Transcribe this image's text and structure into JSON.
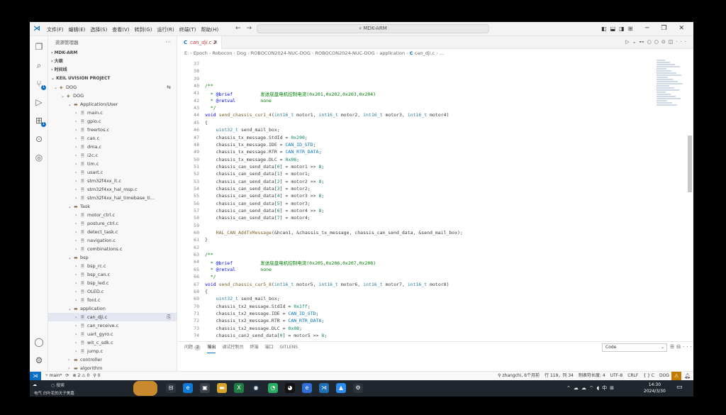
{
  "window": {
    "menus": [
      "文件(F)",
      "编辑(E)",
      "选择(S)",
      "查看(V)",
      "转到(G)",
      "运行(R)",
      "终端(T)",
      "帮助(H)"
    ],
    "command_center": "MDK-ARM"
  },
  "sidebar": {
    "header": "资源管理器",
    "sections": [
      "MDK-ARM",
      "大纲",
      "时间线",
      "KEIL UVISION PROJECT"
    ],
    "tree": [
      {
        "label": "DOG",
        "level": 0,
        "kind": "target",
        "open": true
      },
      {
        "label": "DOG",
        "level": 1,
        "kind": "target",
        "open": true
      },
      {
        "label": "Application/User",
        "level": 2,
        "kind": "folder",
        "open": true
      },
      {
        "label": "main.c",
        "level": 3,
        "kind": "file"
      },
      {
        "label": "gpio.c",
        "level": 3,
        "kind": "file"
      },
      {
        "label": "freertos.c",
        "level": 3,
        "kind": "file"
      },
      {
        "label": "can.c",
        "level": 3,
        "kind": "file"
      },
      {
        "label": "dma.c",
        "level": 3,
        "kind": "file"
      },
      {
        "label": "i2c.c",
        "level": 3,
        "kind": "file"
      },
      {
        "label": "tim.c",
        "level": 3,
        "kind": "file"
      },
      {
        "label": "usart.c",
        "level": 3,
        "kind": "file"
      },
      {
        "label": "stm32f4xx_it.c",
        "level": 3,
        "kind": "file"
      },
      {
        "label": "stm32f4xx_hal_msp.c",
        "level": 3,
        "kind": "file"
      },
      {
        "label": "stm32f4xx_hal_timebase_ti...",
        "level": 3,
        "kind": "file"
      },
      {
        "label": "Task",
        "level": 2,
        "kind": "folder",
        "open": true
      },
      {
        "label": "motor_ctrl.c",
        "level": 3,
        "kind": "file"
      },
      {
        "label": "posture_ctrl.c",
        "level": 3,
        "kind": "file"
      },
      {
        "label": "detect_task.c",
        "level": 3,
        "kind": "file"
      },
      {
        "label": "navigation.c",
        "level": 3,
        "kind": "file"
      },
      {
        "label": "combinations.c",
        "level": 3,
        "kind": "file"
      },
      {
        "label": "bsp",
        "level": 2,
        "kind": "folder",
        "open": true
      },
      {
        "label": "bsp_rc.c",
        "level": 3,
        "kind": "file"
      },
      {
        "label": "bsp_can.c",
        "level": 3,
        "kind": "file"
      },
      {
        "label": "bsp_led.c",
        "level": 3,
        "kind": "file"
      },
      {
        "label": "OLED.c",
        "level": 3,
        "kind": "file"
      },
      {
        "label": "font.c",
        "level": 3,
        "kind": "file"
      },
      {
        "label": "application",
        "level": 2,
        "kind": "folder",
        "open": true
      },
      {
        "label": "can_dji.c",
        "level": 3,
        "kind": "file",
        "selected": true
      },
      {
        "label": "can_receive.c",
        "level": 3,
        "kind": "file"
      },
      {
        "label": "uart_gyro.c",
        "level": 3,
        "kind": "file"
      },
      {
        "label": "wit_c_sdk.c",
        "level": 3,
        "kind": "file"
      },
      {
        "label": "jump.c",
        "level": 3,
        "kind": "file"
      },
      {
        "label": "controller",
        "level": 2,
        "kind": "folder",
        "open": false
      },
      {
        "label": "algorithm",
        "level": 2,
        "kind": "folder",
        "open": false
      }
    ]
  },
  "editor": {
    "tab": {
      "name": "can_dji.c",
      "badge": "2"
    },
    "breadcrumb": [
      "E:",
      "Epoch",
      "Robocon",
      "Dog",
      "ROBOCON2024-NUC-DOG",
      "ROBOCON2024-NUC-DOG",
      "application",
      "can_dji.c",
      "..."
    ],
    "lines": [
      {
        "n": "37",
        "t": ""
      },
      {
        "n": "38",
        "t": ""
      },
      {
        "n": "39",
        "t": ""
      },
      {
        "n": "40",
        "t": "/**"
      },
      {
        "n": "41",
        "t": "  * @brief          发送底盘电机控制电流(0x201,0x202,0x203,0x204)"
      },
      {
        "n": "42",
        "t": "  * @retval         none"
      },
      {
        "n": "43",
        "t": "  */"
      },
      {
        "n": "44",
        "t": "void send_chassis_cur1_4(int16_t motor1, int16_t motor2, int16_t motor3, int16_t motor4)"
      },
      {
        "n": "45",
        "t": "{"
      },
      {
        "n": "46",
        "t": "    uint32_t send_mail_box;"
      },
      {
        "n": "47",
        "t": "    chassis_tx_message.StdId = 0x200;"
      },
      {
        "n": "48",
        "t": "    chassis_tx_message.IDE = CAN_ID_STD;"
      },
      {
        "n": "49",
        "t": "    chassis_tx_message.RTR = CAN_RTR_DATA;"
      },
      {
        "n": "50",
        "t": "    chassis_tx_message.DLC = 0x08;"
      },
      {
        "n": "51",
        "t": "    chassis_can_send_data[0] = motor1 >> 8;"
      },
      {
        "n": "52",
        "t": "    chassis_can_send_data[1] = motor1;"
      },
      {
        "n": "53",
        "t": "    chassis_can_send_data[2] = motor2 >> 8;"
      },
      {
        "n": "54",
        "t": "    chassis_can_send_data[3] = motor2;"
      },
      {
        "n": "55",
        "t": "    chassis_can_send_data[4] = motor3 >> 8;"
      },
      {
        "n": "56",
        "t": "    chassis_can_send_data[5] = motor3;"
      },
      {
        "n": "57",
        "t": "    chassis_can_send_data[6] = motor4 >> 8;"
      },
      {
        "n": "58",
        "t": "    chassis_can_send_data[7] = motor4;"
      },
      {
        "n": "59",
        "t": ""
      },
      {
        "n": "60",
        "t": "    HAL_CAN_AddTxMessage(&hcan1, &chassis_tx_message, chassis_can_send_data, &send_mail_box);"
      },
      {
        "n": "61",
        "t": "}"
      },
      {
        "n": "62",
        "t": ""
      },
      {
        "n": "63",
        "t": "/**"
      },
      {
        "n": "64",
        "t": "  * @brief          发送底盘电机控制电流(0x205,0x206,0x207,0x208)"
      },
      {
        "n": "65",
        "t": "  * @retval         none"
      },
      {
        "n": "66",
        "t": "  */"
      },
      {
        "n": "67",
        "t": "void send_chassis_cur5_8(int16_t motor5, int16_t motor6, int16_t motor7, int16_t motor8)"
      },
      {
        "n": "68",
        "t": "{"
      },
      {
        "n": "69",
        "t": "    uint32_t send_mail_box;"
      },
      {
        "n": "70",
        "t": "    chassis_tx2_message.StdId = 0x1ff;"
      },
      {
        "n": "71",
        "t": "    chassis_tx2_message.IDE = CAN_ID_STD;"
      },
      {
        "n": "72",
        "t": "    chassis_tx2_message.RTR = CAN_RTR_DATA;"
      },
      {
        "n": "73",
        "t": "    chassis_tx2_message.DLC = 0x08;"
      },
      {
        "n": "74",
        "t": "    chassis_can2_send_data[0] = motor5 >> 8;"
      }
    ]
  },
  "panel": {
    "tabs": [
      "问题",
      "输出",
      "调试控制台",
      "终端",
      "端口",
      "GITLENS"
    ],
    "problems_count": "2",
    "active_tab": "输出",
    "output_channel": "Code"
  },
  "statusbar": {
    "branch": "main*",
    "errors_warnings": "⊗ 2 ⚠ 0",
    "ports": "⚲ 0",
    "blame": "zhangchi, 6个月前",
    "position": "行 119，列 34",
    "selection": "制表符长度: 4",
    "encoding": "UTF-8",
    "eol": "CRLF",
    "language": "{ } C",
    "config": "DOG"
  },
  "taskbar": {
    "search": "搜索",
    "weather": "电气 白叶花的天子美嘉",
    "time": "14:30",
    "date": "2024/3/30",
    "ime": "中"
  },
  "colors": {
    "accent": "#0a6fc2",
    "warning": "#c27b00",
    "taskbar": "#20262e"
  }
}
